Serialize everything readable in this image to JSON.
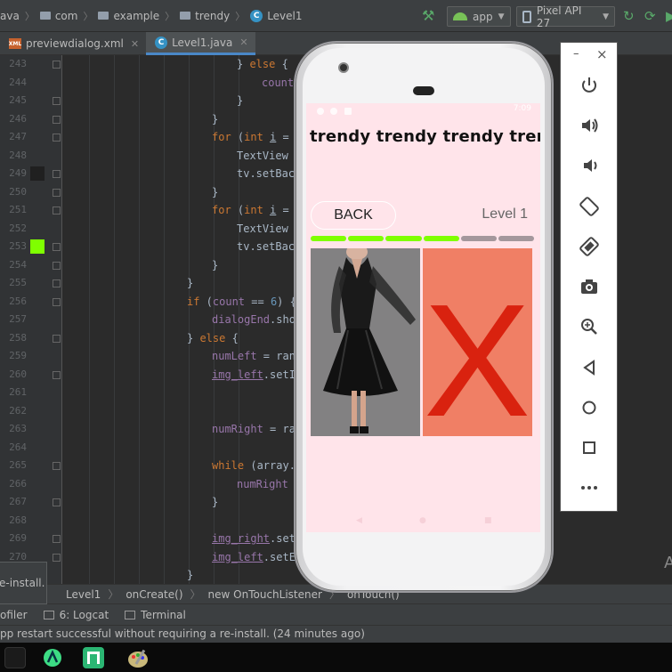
{
  "breadcrumb": {
    "items": [
      "ava",
      "com",
      "example",
      "trendy",
      "Level1"
    ]
  },
  "run_config": {
    "module": "app",
    "device": "Pixel API 27"
  },
  "tabs": [
    {
      "label": "previewdialog.xml",
      "icon": "xml-file-icon",
      "active": false
    },
    {
      "label": "Level1.java",
      "icon": "java-class-icon",
      "active": true
    }
  ],
  "editor": {
    "line_numbers": [
      "243",
      "244",
      "245",
      "246",
      "247",
      "248",
      "249",
      "250",
      "251",
      "252",
      "253",
      "254",
      "255",
      "256",
      "257",
      "258",
      "259",
      "260",
      "261",
      "262",
      "263",
      "264",
      "265",
      "266",
      "267",
      "268",
      "269",
      "270",
      "271"
    ],
    "color_swatches": [
      {
        "line": "249",
        "color": "#202020"
      },
      {
        "line": "253",
        "color": "#7fff00"
      }
    ],
    "lines": [
      {
        "text": "} else {"
      },
      {
        "text": "count"
      },
      {
        "text": "}"
      },
      {
        "text": "}"
      },
      {
        "text": "for (int i ="
      },
      {
        "text": "TextView"
      },
      {
        "text": "tv.setBac"
      },
      {
        "text": "}"
      },
      {
        "text": "for (int i ="
      },
      {
        "text": "TextView"
      },
      {
        "text": "tv.setBac"
      },
      {
        "text": "}"
      },
      {
        "text": "}"
      },
      {
        "text": "if (count == 6) {"
      },
      {
        "text": "dialogEnd.sho"
      },
      {
        "text": "} else {"
      },
      {
        "text": "numLeft = ran"
      },
      {
        "text": "img_left.setI"
      },
      {
        "text": ""
      },
      {
        "text": ""
      },
      {
        "text": "numRight = ra"
      },
      {
        "text": ""
      },
      {
        "text": "while (array."
      },
      {
        "text": "numRight"
      },
      {
        "text": "}"
      },
      {
        "text": ""
      },
      {
        "text": "img_right.set"
      },
      {
        "text": "img_left.setE"
      },
      {
        "text": "}"
      }
    ]
  },
  "bottom_breadcrumb": [
    "Level1",
    "onCreate()",
    "new OnTouchListener",
    "onTouch()"
  ],
  "tool_windows": [
    "ofiler",
    "6: Logcat",
    "Terminal"
  ],
  "status": "pp restart successful without requiring a re-install. (24 minutes ago)",
  "balloon": "e-install.",
  "side_letters": "A",
  "phone": {
    "status_time": "7:09",
    "title": "trendy trendy trendy trendy",
    "back_label": "BACK",
    "level_label": "Level 1",
    "progress": {
      "filled": 4,
      "total": 6
    },
    "progress_colors": {
      "filled": "#7fff00",
      "empty": "#a4979c"
    },
    "right_image_mark": "X",
    "colors": {
      "background": "#ffe4ea",
      "x_panel": "#f07f65",
      "x_mark": "#d9220f"
    }
  },
  "emulator_controls": {
    "minimize": "–",
    "close": "×",
    "buttons": [
      "power-icon",
      "volume-up-icon",
      "volume-down-icon",
      "rotate-left-icon",
      "rotate-right-icon",
      "camera-icon",
      "zoom-in-icon",
      "back-icon",
      "home-icon",
      "overview-icon",
      "more-icon"
    ]
  }
}
